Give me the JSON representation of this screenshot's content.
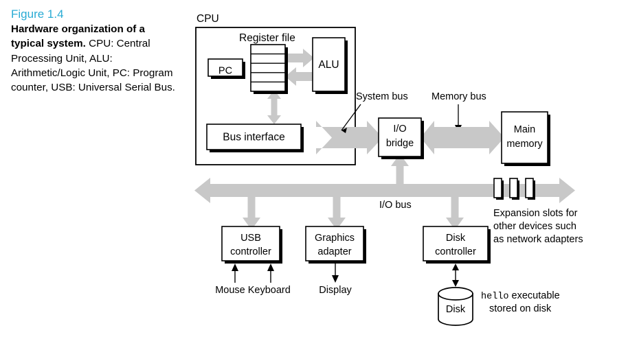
{
  "caption": {
    "figure_number": "Figure 1.4",
    "title": "Hardware organization of a typical system.",
    "body": " CPU: Central Processing Unit, ALU: Arithmetic/Logic Unit, PC: Program counter, USB: Universal Serial Bus."
  },
  "diagram": {
    "cpu_label": "CPU",
    "register_file_label": "Register file",
    "pc_label": "PC",
    "alu_label": "ALU",
    "bus_interface_label": "Bus interface",
    "system_bus_label": "System bus",
    "memory_bus_label": "Memory bus",
    "io_bridge_line1": "I/O",
    "io_bridge_line2": "bridge",
    "main_memory_line1": "Main",
    "main_memory_line2": "memory",
    "io_bus_label": "I/O bus",
    "expansion_line1": "Expansion slots for",
    "expansion_line2": "other devices such",
    "expansion_line3": "as network adapters",
    "usb_line1": "USB",
    "usb_line2": "controller",
    "graphics_line1": "Graphics",
    "graphics_line2": "adapter",
    "disk_ctrl_line1": "Disk",
    "disk_ctrl_line2": "controller",
    "mouse_keyboard_label": "Mouse Keyboard",
    "display_label": "Display",
    "disk_label": "Disk",
    "hello_mono": "hello",
    "hello_rest": " executable",
    "stored_label": "stored on disk"
  },
  "colors": {
    "figure_number": "#29abd4",
    "bus_gray": "#c8c8c8",
    "line_black": "#000000",
    "box_white": "#ffffff"
  }
}
